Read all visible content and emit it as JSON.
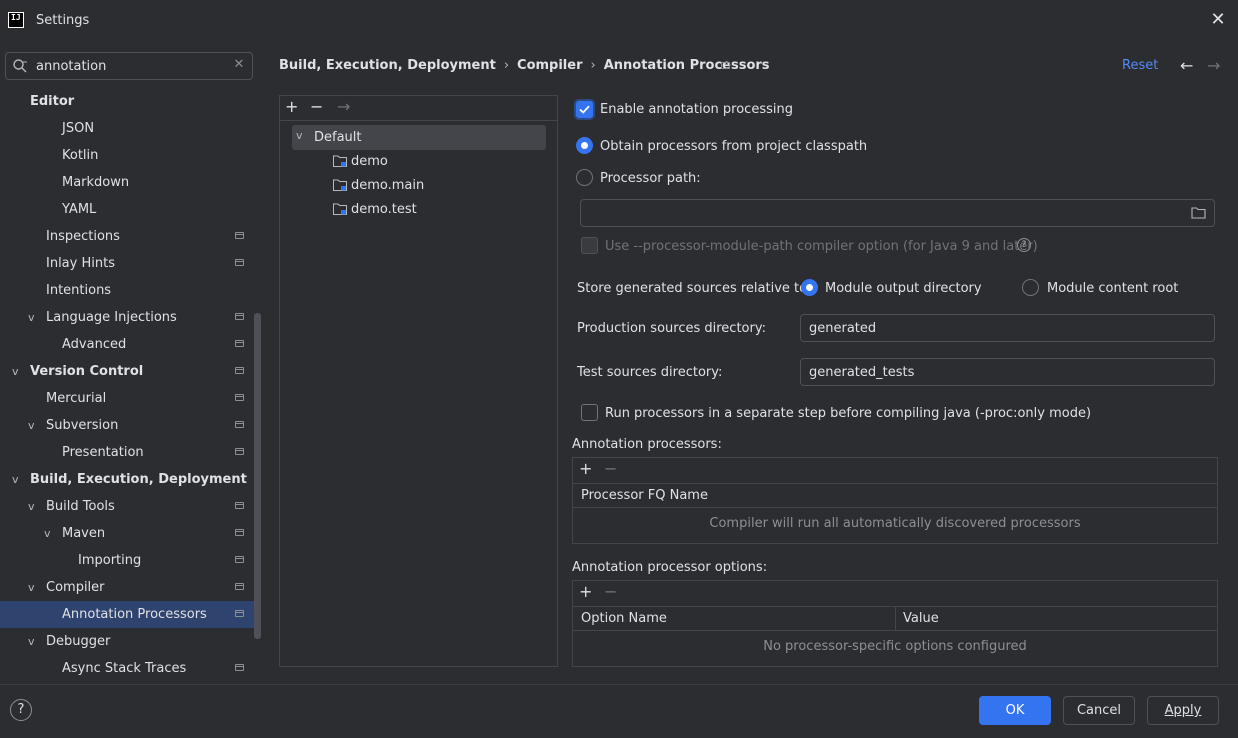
{
  "window": {
    "title": "Settings"
  },
  "search": {
    "value": "annotation",
    "placeholder": ""
  },
  "tree": [
    {
      "label": "Editor",
      "bold": true,
      "indent": 0,
      "chevron": "",
      "page_icon": false
    },
    {
      "label": "JSON",
      "bold": false,
      "indent": 2,
      "chevron": "",
      "page_icon": false
    },
    {
      "label": "Kotlin",
      "bold": false,
      "indent": 2,
      "chevron": "",
      "page_icon": false
    },
    {
      "label": "Markdown",
      "bold": false,
      "indent": 2,
      "chevron": "",
      "page_icon": false
    },
    {
      "label": "YAML",
      "bold": false,
      "indent": 2,
      "chevron": "",
      "page_icon": false
    },
    {
      "label": "Inspections",
      "bold": false,
      "indent": 1,
      "chevron": "",
      "page_icon": true
    },
    {
      "label": "Inlay Hints",
      "bold": false,
      "indent": 1,
      "chevron": "",
      "page_icon": true
    },
    {
      "label": "Intentions",
      "bold": false,
      "indent": 1,
      "chevron": "",
      "page_icon": false
    },
    {
      "label": "Language Injections",
      "bold": false,
      "indent": 1,
      "chevron": "v",
      "page_icon": true
    },
    {
      "label": "Advanced",
      "bold": false,
      "indent": 2,
      "chevron": "",
      "page_icon": true
    },
    {
      "label": "Version Control",
      "bold": true,
      "indent": 0,
      "chevron": "v",
      "page_icon": true
    },
    {
      "label": "Mercurial",
      "bold": false,
      "indent": 1,
      "chevron": "",
      "page_icon": true
    },
    {
      "label": "Subversion",
      "bold": false,
      "indent": 1,
      "chevron": "v",
      "page_icon": true
    },
    {
      "label": "Presentation",
      "bold": false,
      "indent": 2,
      "chevron": "",
      "page_icon": true
    },
    {
      "label": "Build, Execution, Deployment",
      "bold": true,
      "indent": 0,
      "chevron": "v",
      "page_icon": false
    },
    {
      "label": "Build Tools",
      "bold": false,
      "indent": 1,
      "chevron": "v",
      "page_icon": true
    },
    {
      "label": "Maven",
      "bold": false,
      "indent": 2,
      "chevron": "v",
      "page_icon": true
    },
    {
      "label": "Importing",
      "bold": false,
      "indent": 3,
      "chevron": "",
      "page_icon": true
    },
    {
      "label": "Compiler",
      "bold": false,
      "indent": 1,
      "chevron": "v",
      "page_icon": true
    },
    {
      "label": "Annotation Processors",
      "bold": false,
      "indent": 2,
      "chevron": "",
      "page_icon": true,
      "selected": true
    },
    {
      "label": "Debugger",
      "bold": false,
      "indent": 1,
      "chevron": "v",
      "page_icon": false
    },
    {
      "label": "Async Stack Traces",
      "bold": false,
      "indent": 2,
      "chevron": "",
      "page_icon": true
    }
  ],
  "breadcrumb": {
    "items": [
      "Build, Execution, Deployment",
      "Compiler",
      "Annotation Processors"
    ]
  },
  "header": {
    "reset_label": "Reset"
  },
  "profiles": {
    "default_label": "Default",
    "modules": [
      "demo",
      "demo.main",
      "demo.test"
    ]
  },
  "settings": {
    "enable_label": "Enable annotation processing",
    "enable_checked": true,
    "obtain_label": "Obtain processors from project classpath",
    "processor_path_label": "Processor path:",
    "processor_path_value": "",
    "module_path_label": "Use --processor-module-path compiler option (for Java 9 and later)",
    "store_label": "Store generated sources relative to:",
    "module_output_label": "Module output directory",
    "module_content_label": "Module content root",
    "production_label": "Production sources directory:",
    "production_value": "generated",
    "test_label": "Test sources directory:",
    "test_value": "generated_tests",
    "separate_step_label": "Run processors in a separate step before compiling java (-proc:only mode)"
  },
  "processors_table": {
    "title": "Annotation processors:",
    "column": "Processor FQ Name",
    "empty": "Compiler will run all automatically discovered processors"
  },
  "options_table": {
    "title": "Annotation processor options:",
    "columns": [
      "Option Name",
      "Value"
    ],
    "empty": "No processor-specific options configured"
  },
  "footer": {
    "help": "?",
    "ok": "OK",
    "cancel": "Cancel",
    "apply": "Apply"
  },
  "colors": {
    "accent": "#3574f0",
    "link": "#548af7",
    "selection": "#2e436e",
    "background": "#2b2d30"
  }
}
